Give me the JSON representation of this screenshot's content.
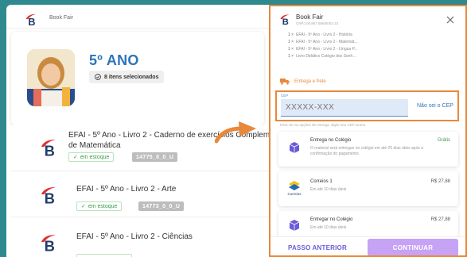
{
  "header": {
    "title": "Book Fair"
  },
  "grade_card": {
    "grade": "5º ANO",
    "selected_count": "8 itens selecionados"
  },
  "products": [
    {
      "name_line1": "EFAI - 5º Ano - Livro 2 - Caderno de exercícios Complem",
      "name_line2": "de Matemática",
      "stock": "em estoque",
      "sku": "14775_0_0_U"
    },
    {
      "name_line1": "EFAI - 5º Ano - Livro 2 - Arte",
      "name_line2": "",
      "stock": "em estoque",
      "sku": "14773_0_0_U"
    },
    {
      "name_line1": "EFAI - 5º Ano - Livro 2 - Ciências",
      "name_line2": "",
      "stock": "",
      "sku": ""
    }
  ],
  "drawer": {
    "title": "Book Fair",
    "subtitle": "CNPJ 06.867.686/0001-22",
    "items": [
      {
        "qty": "1 ×",
        "name": "EFAI - 5º Ano - Livro 2 - História"
      },
      {
        "qty": "1 ×",
        "name": "EFAI - 5º Ano - Livro 2 - Matemát..."
      },
      {
        "qty": "1 ×",
        "name": "EFAI - 5º Ano - Livro 2 - Língua P..."
      },
      {
        "qty": "1 ×",
        "name": "Livro Didático Colégio dos Sonh..."
      }
    ],
    "shipping_label": "Entrega e frete",
    "cep": {
      "label": "CEP",
      "placeholder": "XXXXX-XXX",
      "link": "Não sei o CEP",
      "hint": "Para ver as opções de entrega, digite seu CEP acima."
    },
    "options": [
      {
        "title": "Entrega no Colégio",
        "price": "Grátis",
        "desc": "O material será entregue no colégio em até 25 dias úteis após a confirmação do pagamento."
      },
      {
        "title": "Correios 1",
        "price": "R$ 27,88",
        "desc": "Em até 10 dias úteis",
        "icon_text": "Correios"
      },
      {
        "title": "Entregar no Colégio",
        "price": "R$ 27,88",
        "desc": "Em até 10 dias úteis"
      }
    ],
    "back_button": "PASSO ANTERIOR",
    "continue_button": "CONTINUAR"
  },
  "colors": {
    "accent_orange": "#e8883a",
    "brand_blue": "#2e75b6",
    "teal_bg": "#2f8a8f",
    "purple": "#c6a3f5",
    "logo_red": "#e0312a",
    "logo_navy": "#1f3a68"
  }
}
